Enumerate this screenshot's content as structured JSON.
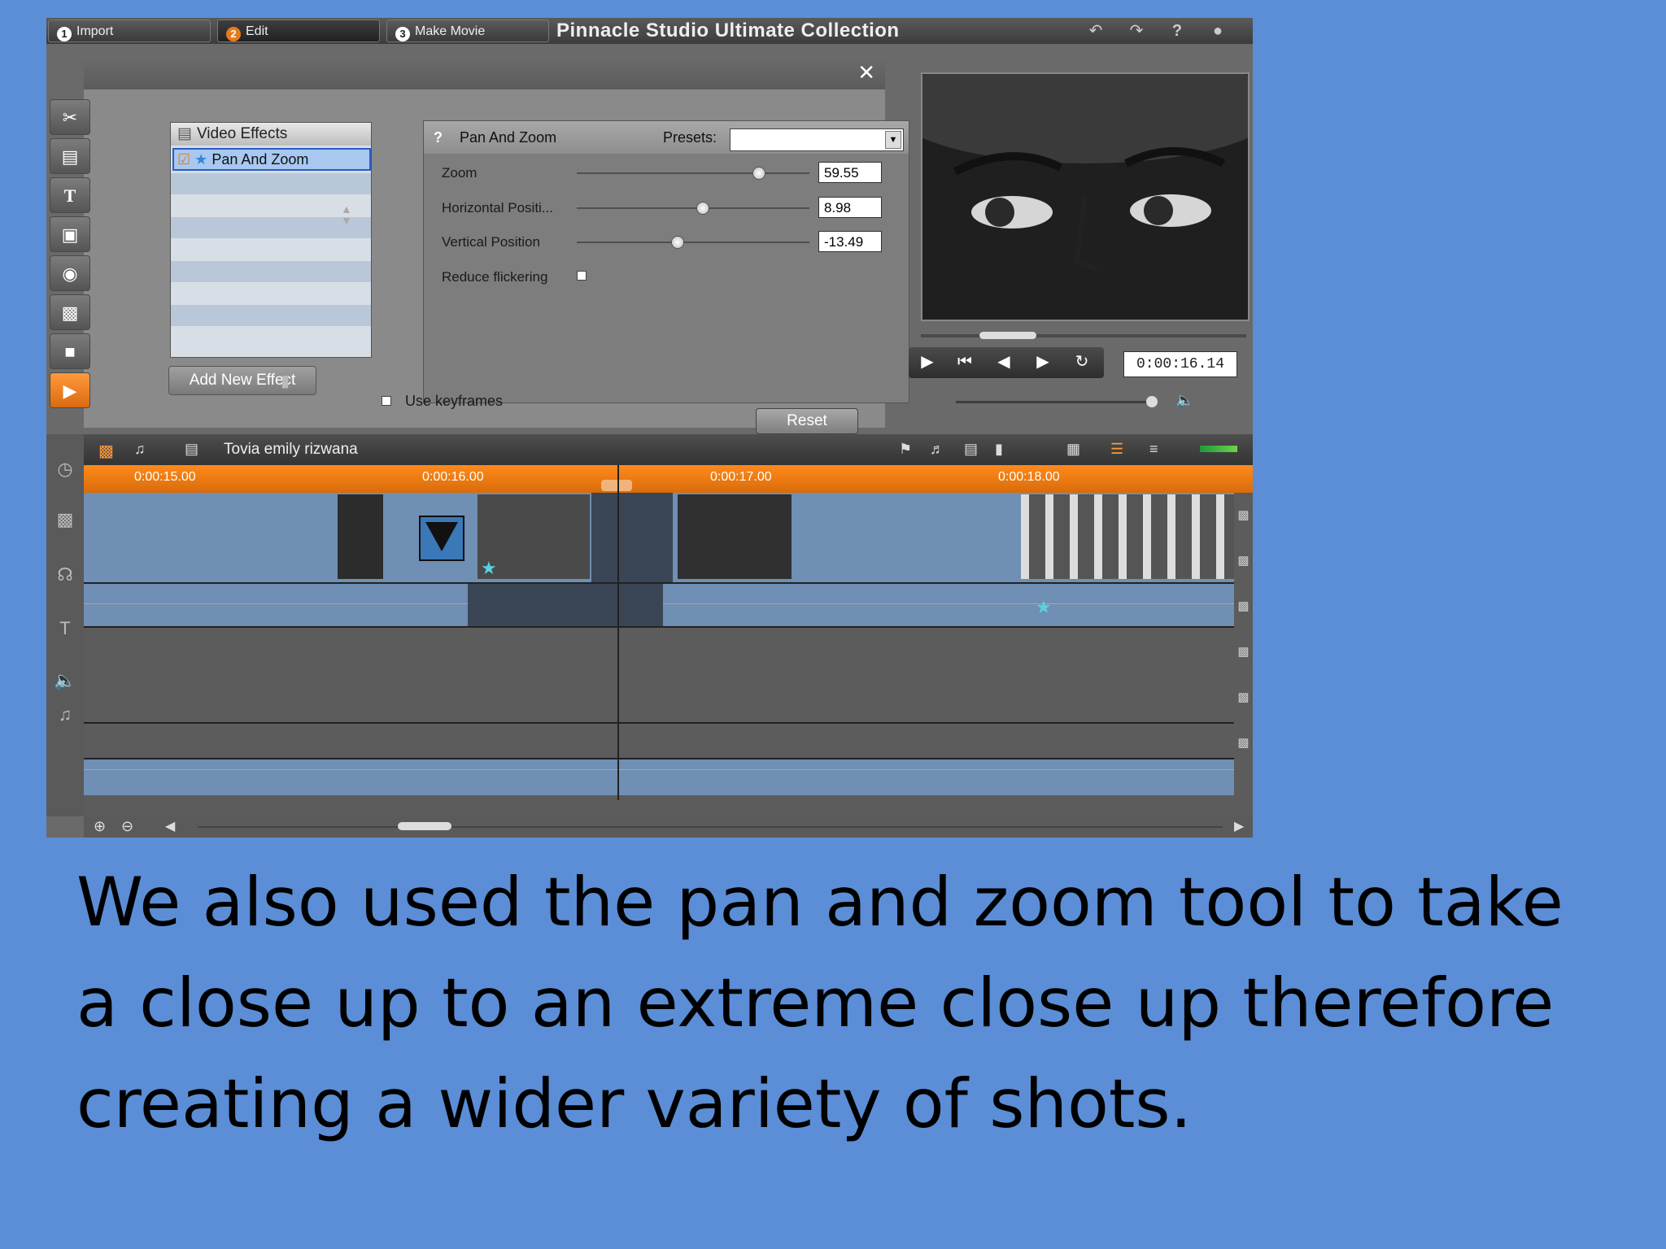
{
  "app": {
    "title": "Pinnacle Studio Ultimate Collection",
    "steps": [
      {
        "num": "1",
        "label": "Import"
      },
      {
        "num": "2",
        "label": "Edit"
      },
      {
        "num": "3",
        "label": "Make Movie"
      }
    ]
  },
  "effects": {
    "header": "Video Effects",
    "selected_item": "Pan And Zoom",
    "add_button": "Add New Effect"
  },
  "properties": {
    "help": "?",
    "title": "Pan And Zoom",
    "presets_label": "Presets:",
    "presets_value": "",
    "params": [
      {
        "label": "Zoom",
        "value": "59.55",
        "level": 0.78
      },
      {
        "label": "Horizontal Positi...",
        "value": "8.98",
        "level": 0.54
      },
      {
        "label": "Vertical Position",
        "value": "-13.49",
        "level": 0.43
      }
    ],
    "reduce_flicker_label": "Reduce flickering",
    "use_keyframes_label": "Use keyframes",
    "reset_button": "Reset"
  },
  "player": {
    "timecode": "0:00:16.14"
  },
  "timeline": {
    "project_name": "Tovia emily rizwana",
    "ruler_labels": [
      "0:00:15.00",
      "0:00:16.00",
      "0:00:17.00",
      "0:00:18.00"
    ]
  },
  "caption": {
    "text": "We also used the pan and zoom tool to take a close up to an extreme close up therefore creating a wider variety of shots."
  },
  "colors": {
    "background": "#5b8ed6",
    "accent": "#e47b1c",
    "track": "#6f8fb4"
  }
}
